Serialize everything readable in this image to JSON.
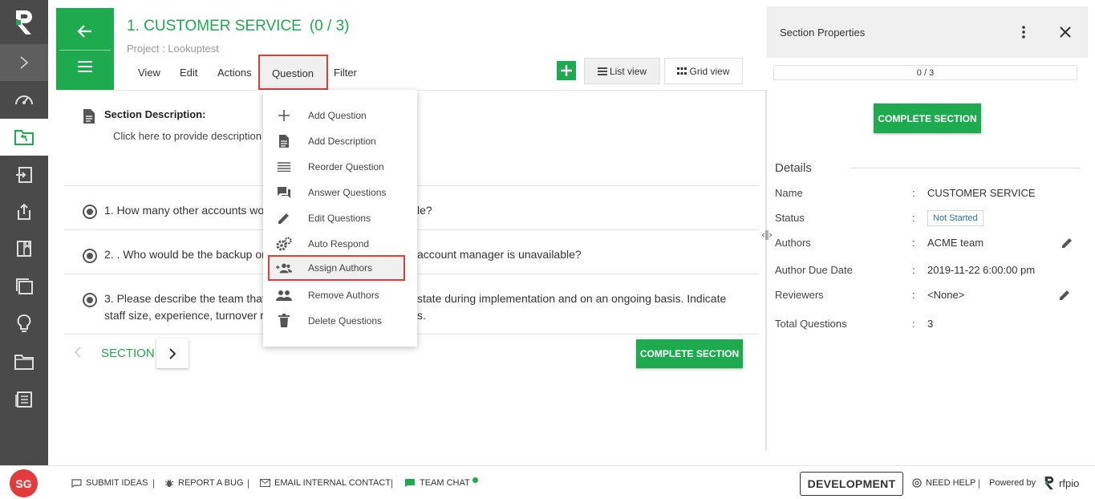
{
  "header": {
    "title": "1. CUSTOMER SERVICE",
    "count": "(0 / 3)",
    "project": "Project : Lookuptest"
  },
  "menu": {
    "view": "View",
    "edit": "Edit",
    "actions": "Actions",
    "question": "Question",
    "filter": "Filter"
  },
  "toolbar": {
    "list_view": "List view",
    "grid_view": "Grid view"
  },
  "section": {
    "desc_title": "Section Description:",
    "desc_hint": "Click here to provide description"
  },
  "questions": [
    {
      "text": "1. How many other accounts wo",
      "tail": "le?"
    },
    {
      "text": "2. . Who would be the backup or",
      "tail": "account manager is unavailable?"
    },
    {
      "text": "3. Please describe the team that",
      "tail": "state during implementation and on an ongoing basis. Indicate",
      "line2": "staff size, experience, turnover r",
      "line2_tail": "s."
    }
  ],
  "nav": {
    "section_label": "SECTION",
    "complete_label": "COMPLETE SECTION"
  },
  "dropdown": [
    {
      "label": "Add Question",
      "icon": "plus-icon"
    },
    {
      "label": "Add Description",
      "icon": "document-icon"
    },
    {
      "label": "Reorder Question",
      "icon": "reorder-icon"
    },
    {
      "label": "Answer Questions",
      "icon": "chat-icon"
    },
    {
      "label": "Edit Questions",
      "icon": "pencil-icon"
    },
    {
      "label": "Auto Respond",
      "icon": "gears-icon"
    },
    {
      "label": "Assign Authors",
      "icon": "add-group-icon"
    },
    {
      "label": "Remove Authors",
      "icon": "group-icon"
    },
    {
      "label": "Delete Questions",
      "icon": "trash-icon"
    }
  ],
  "panel": {
    "title": "Section Properties",
    "progress": "0 / 3",
    "complete_label": "COMPLETE SECTION",
    "details_title": "Details",
    "colon": ":",
    "name_label": "Name",
    "name_value": "CUSTOMER SERVICE",
    "status_label": "Status",
    "status_value": "Not Started",
    "authors_label": "Authors",
    "authors_value": "ACME team",
    "due_label": "Author Due Date",
    "due_value": "2019-11-22 6:00:00 pm",
    "reviewers_label": "Reviewers",
    "reviewers_value": "<None>",
    "total_label": "Total Questions",
    "total_value": "3"
  },
  "footer": {
    "avatar": "SG",
    "submit_ideas": "SUBMIT IDEAS",
    "report_bug": "REPORT A BUG",
    "email_contact": "EMAIL INTERNAL CONTACT",
    "team_chat": "TEAM CHAT",
    "sep": "|",
    "env": "DEVELOPMENT",
    "need_help": "NEED HELP",
    "powered_by": "Powered by",
    "brand": "rfpio"
  },
  "colors": {
    "brand_green": "#1eaa4f",
    "highlight_red": "#e03c3c",
    "sidebar_bg": "#4a4a4a"
  }
}
